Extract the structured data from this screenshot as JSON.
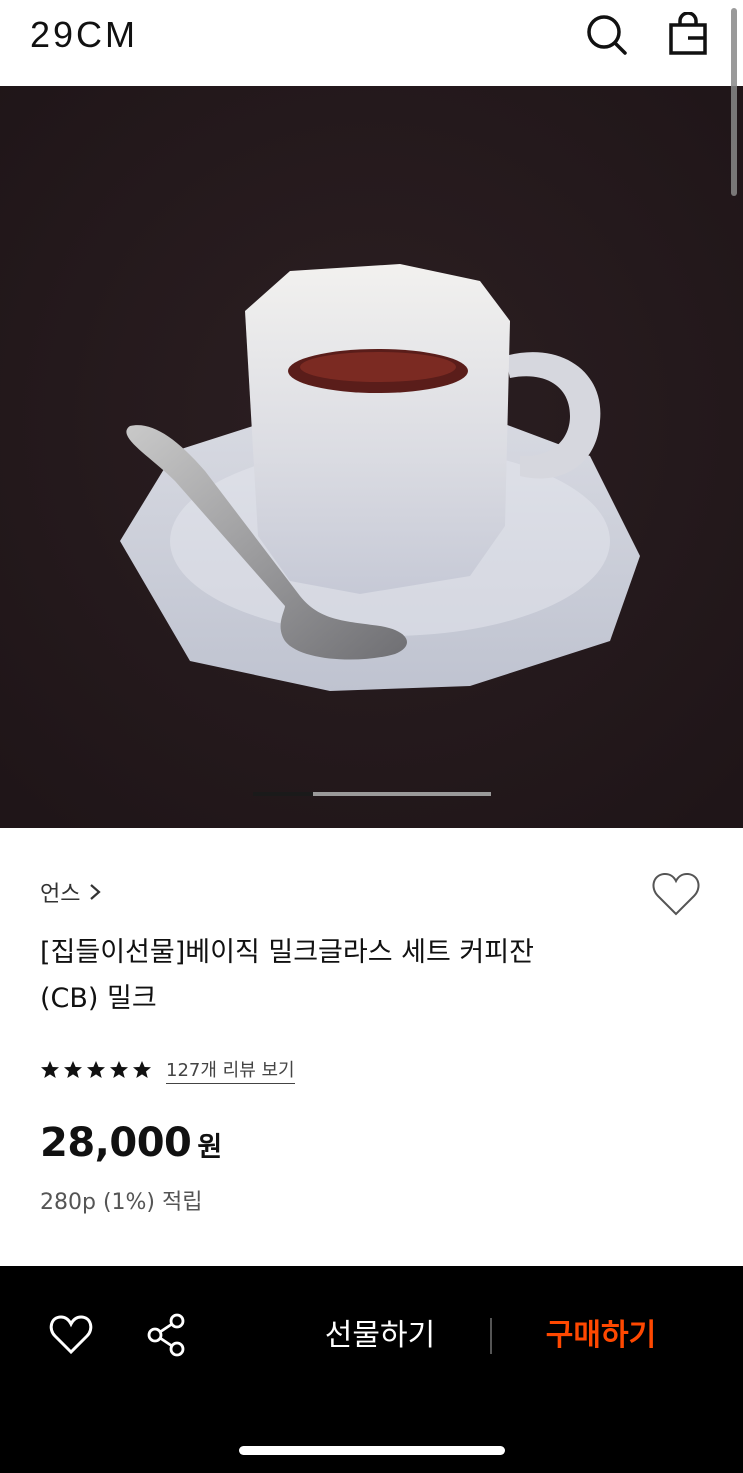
{
  "header": {
    "logo": "29CM",
    "icons": [
      "search-icon",
      "shopping-bag-icon"
    ]
  },
  "gallery": {
    "image": "white octagonal milk glass coffee cup with saucer and spoon on dark background",
    "current_index": 1,
    "total_images": 4
  },
  "product": {
    "brand": "언스",
    "title_line1": "[집들이선물]베이직 밀크글라스 세트 커피잔",
    "title_line2": "(CB) 밀크",
    "rating_stars": 5,
    "review_link": "127개 리뷰 보기",
    "price": "28,000",
    "price_unit": "원",
    "points": "280p (1%) 적립"
  },
  "bottom_bar": {
    "gift_label": "선물하기",
    "buy_label": "구매하기",
    "buy_color": "#ff4800"
  },
  "colors": {
    "hero_bg": "#24181b",
    "text": "#111111",
    "bar_bg": "#000000"
  }
}
